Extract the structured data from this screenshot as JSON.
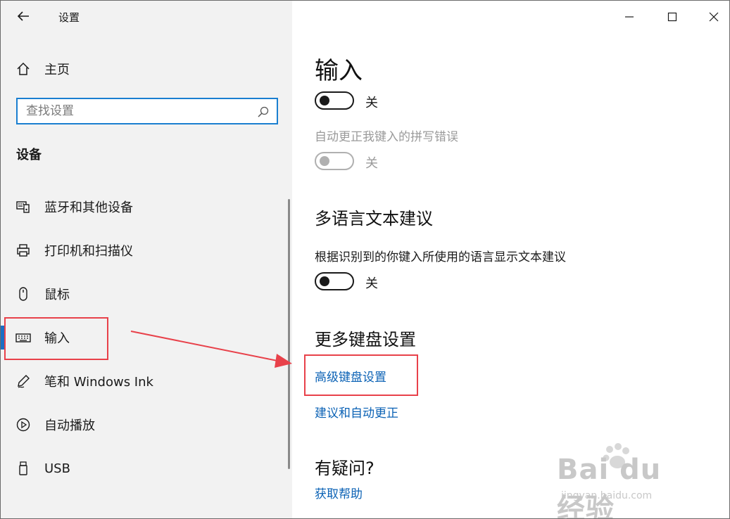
{
  "window": {
    "title": "设置",
    "controls": [
      "minimize",
      "maximize",
      "close"
    ]
  },
  "sidebar": {
    "home_label": "主页",
    "search_placeholder": "查找设置",
    "section_title": "设备",
    "items": [
      {
        "label": "蓝牙和其他设备",
        "icon": "bluetooth-devices-icon"
      },
      {
        "label": "打印机和扫描仪",
        "icon": "printer-icon"
      },
      {
        "label": "鼠标",
        "icon": "mouse-icon"
      },
      {
        "label": "输入",
        "icon": "keyboard-icon",
        "selected": true
      },
      {
        "label": "笔和 Windows Ink",
        "icon": "pen-icon"
      },
      {
        "label": "自动播放",
        "icon": "autoplay-icon"
      },
      {
        "label": "USB",
        "icon": "usb-icon"
      }
    ]
  },
  "main": {
    "page_title": "输入",
    "toggle1_state": "关",
    "autocorrect_desc": "自动更正我键入的拼写错误",
    "toggle2_state": "关",
    "multilang_title": "多语言文本建议",
    "multilang_desc": "根据识别到的你键入所使用的语言显示文本建议",
    "toggle3_state": "关",
    "more_keyboard_title": "更多键盘设置",
    "advanced_keyboard_link": "高级键盘设置",
    "suggestions_link": "建议和自动更正",
    "questions_title": "有疑问?",
    "help_link": "获取帮助"
  },
  "colors": {
    "accent": "#1a6fc4",
    "link": "#0b62b5",
    "annotation_red": "#e8414a",
    "search_border": "#1a7fd0"
  },
  "watermark": {
    "brand": "Bai du 经验",
    "url": "jingyan.baidu.com"
  }
}
